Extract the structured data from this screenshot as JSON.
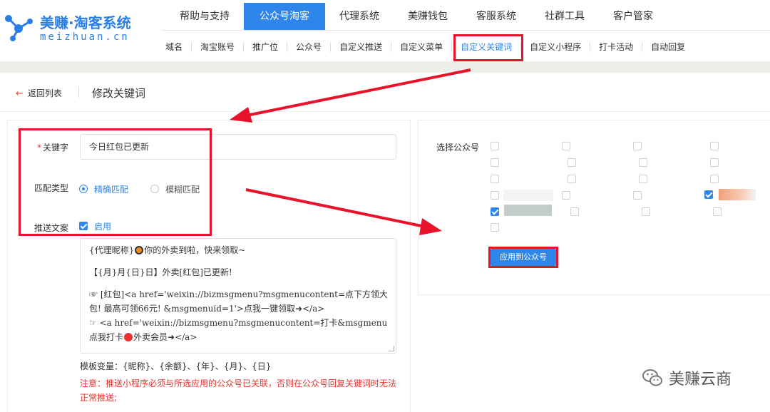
{
  "brand": {
    "name": "美赚·淘客系统",
    "domain": "meizhuan.cn",
    "color": "#2a7ee8"
  },
  "topnav": [
    {
      "label": "帮助与支持",
      "active": false
    },
    {
      "label": "公众号淘客",
      "active": true
    },
    {
      "label": "代理系统",
      "active": false
    },
    {
      "label": "美赚钱包",
      "active": false
    },
    {
      "label": "客服系统",
      "active": false
    },
    {
      "label": "社群工具",
      "active": false
    },
    {
      "label": "客户管家",
      "active": false
    }
  ],
  "subnav": [
    {
      "label": "域名",
      "active": false
    },
    {
      "label": "淘宝账号",
      "active": false
    },
    {
      "label": "推广位",
      "active": false
    },
    {
      "label": "公众号",
      "active": false
    },
    {
      "label": "自定义推送",
      "active": false
    },
    {
      "label": "自定义菜单",
      "active": false
    },
    {
      "label": "自定义关键词",
      "active": true
    },
    {
      "label": "自定义小程序",
      "active": false
    },
    {
      "label": "打卡活动",
      "active": false
    },
    {
      "label": "自动回复",
      "active": false
    }
  ],
  "breadcrumb": {
    "back": "返回列表",
    "title": "修改关键词"
  },
  "form": {
    "keyword_label": "关键字",
    "keyword_value": "今日红包已更新",
    "match_label": "匹配类型",
    "match_options": [
      {
        "label": "精确匹配",
        "selected": true
      },
      {
        "label": "模糊匹配",
        "selected": false
      }
    ],
    "push_label": "推送文案",
    "push_enable_label": "启用",
    "push_enabled": true,
    "content_lines": {
      "l1a": "{代理昵称}",
      "l1b": "你的外卖到啦，快来领取~",
      "l2": "【{月}月{日}日】外卖[红包]已更新!",
      "l3": "☞ [红包]<a href='weixin://bizmsgmenu?msgmenucontent=点下方领大红",
      "l4": "包! 最高可领66元! &msgmenuid=1'>点我一键领取➜</a>",
      "l5": "☞ <a href='weixin://bizmsgmenu?msgmenucontent=打卡&msgmenuid=1'>",
      "l6a": "点我打卡",
      "l6b": "外卖会员➜</a>"
    },
    "template_vars": "模板变量：{昵称}、{余额}、{年}、{月}、{日}",
    "note": "注意：推送小程序必须与所选应用的公众号已关联，否则在公众号回复关键词时无法正常推送;"
  },
  "accounts": {
    "label": "选择公众号",
    "apply_label": "应用到公众号",
    "checked_count": 2
  },
  "watermark": "美赚云商"
}
